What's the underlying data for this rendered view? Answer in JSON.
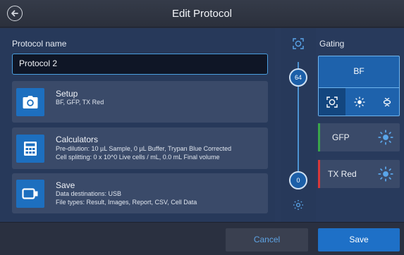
{
  "header": {
    "title": "Edit Protocol",
    "back_icon": "back-arrow-circle-icon"
  },
  "protocol": {
    "label": "Protocol name",
    "value": "Protocol 2"
  },
  "cards": {
    "setup": {
      "title": "Setup",
      "lines": [
        "BF, GFP, TX Red"
      ],
      "icon": "camera-icon"
    },
    "calculators": {
      "title": "Calculators",
      "lines": [
        "Pre-dilution: 10 µL Sample, 0 µL Buffer, Trypan Blue Corrected",
        "Cell splitting: 0 x 10^0 Live cells / mL, 0.0 mL Final volume"
      ],
      "icon": "calculator-icon"
    },
    "save": {
      "title": "Save",
      "lines": [
        "Data destinations: USB",
        "File types: Result, Images, Report, CSV, Cell Data"
      ],
      "icon": "usb-drive-icon"
    }
  },
  "slider": {
    "top_value": "64",
    "bottom_value": "0",
    "top_icon": "focus-frame-icon",
    "bottom_icon": "dim-light-icon"
  },
  "gating": {
    "label": "Gating",
    "bf": {
      "label": "BF",
      "modes": [
        "focus-frame-icon",
        "light-icon",
        "contrast-icon"
      ],
      "selected_mode": 0
    },
    "channels": [
      {
        "label": "GFP",
        "color": "#3aa64a",
        "icon": "light-icon"
      },
      {
        "label": "TX Red",
        "color": "#d8383a",
        "icon": "light-icon"
      }
    ]
  },
  "footer": {
    "cancel": "Cancel",
    "save": "Save"
  },
  "colors": {
    "accent": "#1e70c7",
    "panel": "#3a4a69",
    "background": "#27395a"
  }
}
